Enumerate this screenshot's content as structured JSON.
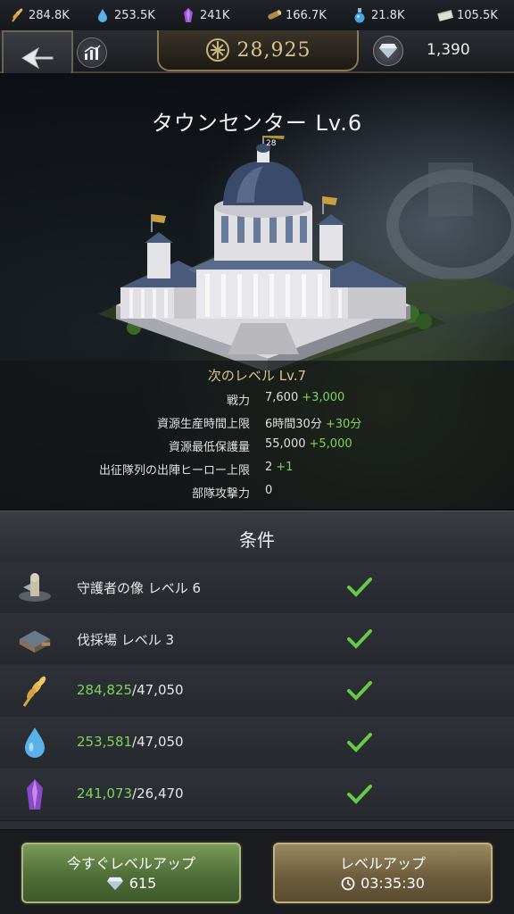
{
  "resources": [
    {
      "name": "wheat-icon",
      "value": "284.8K"
    },
    {
      "name": "water-icon",
      "value": "253.5K"
    },
    {
      "name": "crystal-icon",
      "value": "241K"
    },
    {
      "name": "wood-icon",
      "value": "166.7K"
    },
    {
      "name": "potion-icon",
      "value": "21.8K"
    },
    {
      "name": "money-icon",
      "value": "105.5K"
    }
  ],
  "header": {
    "power": "28,925",
    "gems": "1,390"
  },
  "building": {
    "title": "タウンセンター Lv.6",
    "flag_text": "28",
    "next_level": "次のレベル Lv.7",
    "stats": [
      {
        "label": "戦力",
        "value": "7,600",
        "inc": "+3,000"
      },
      {
        "label": "資源生産時間上限",
        "value": "6時間30分",
        "inc": "+30分"
      },
      {
        "label": "資源最低保護量",
        "value": "55,000",
        "inc": "+5,000"
      },
      {
        "label": "出征隊列の出陣ヒーロー上限",
        "value": "2",
        "inc": "+1"
      },
      {
        "label": "部隊攻撃力",
        "value": "0",
        "inc": ""
      }
    ]
  },
  "conditions": {
    "title": "条件",
    "items": [
      {
        "text": "守護者の像 レベル 6",
        "have": "",
        "need": ""
      },
      {
        "text": "伐採場 レベル 3",
        "have": "",
        "need": ""
      },
      {
        "text": "",
        "have": "284,825",
        "need": "/47,050"
      },
      {
        "text": "",
        "have": "253,581",
        "need": "/47,050"
      },
      {
        "text": "",
        "have": "241,073",
        "need": "/26,470"
      }
    ]
  },
  "buttons": {
    "instant_label": "今すぐレベルアップ",
    "instant_cost": "615",
    "upgrade_label": "レベルアップ",
    "upgrade_time": "03:35:30"
  },
  "colors": {
    "increase": "#7ed45a",
    "gold": "#d8c48c"
  }
}
